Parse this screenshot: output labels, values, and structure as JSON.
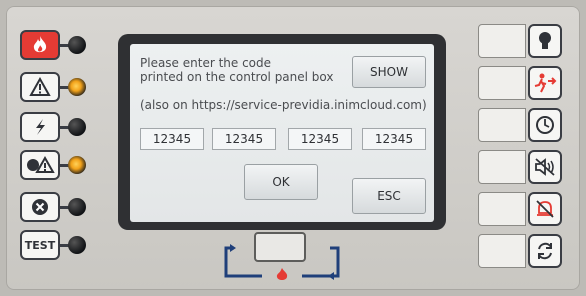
{
  "screen": {
    "prompt_line1": "Please enter the code",
    "prompt_line2": "printed on the control panel box",
    "show_label": "SHOW",
    "url_note": "(also on https://service-previdia.inimcloud.com)",
    "codes": [
      "12345",
      "12345",
      "12345",
      "12345"
    ],
    "ok_label": "OK",
    "esc_label": "ESC"
  },
  "left_panel": {
    "test_label": "TEST",
    "indicators": [
      {
        "name": "fire-icon",
        "led": "off"
      },
      {
        "name": "warning-icon",
        "led": "on"
      },
      {
        "name": "fault-icon",
        "led": "off"
      },
      {
        "name": "disabled-warning-icon",
        "led": "on"
      },
      {
        "name": "exclusion-icon",
        "led": "off"
      },
      {
        "name": "test-icon",
        "led": "off"
      }
    ]
  },
  "right_panel": {
    "icons": [
      "lightbulb-icon",
      "evacuation-icon",
      "clock-icon",
      "mute-icon",
      "alarm-silence-icon",
      "reset-icon"
    ]
  },
  "colors": {
    "fire_red": "#e53b34",
    "led_amber": "#f2a21a",
    "screen_bg": "#e8ebec",
    "bezel": "#2f3033"
  }
}
